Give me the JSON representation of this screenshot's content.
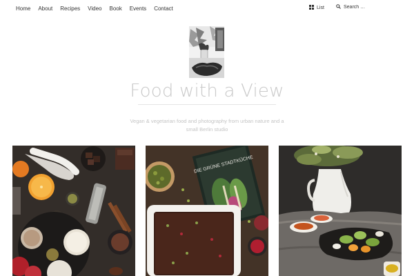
{
  "nav": {
    "items": [
      {
        "label": "Home"
      },
      {
        "label": "About"
      },
      {
        "label": "Recipes"
      },
      {
        "label": "Video"
      },
      {
        "label": "Book"
      },
      {
        "label": "Events"
      },
      {
        "label": "Contact"
      }
    ],
    "view_toggle": {
      "label": "List",
      "icon": "grid-icon"
    },
    "search": {
      "placeholder": "Search …",
      "icon": "search-icon"
    }
  },
  "header": {
    "title": "Food with a View",
    "tagline": "Vegan & vegetarian food and photography from urban nature and a small Berlin studio"
  },
  "posts": [
    {
      "image": "ingredients-flatlay-photo"
    },
    {
      "image": "cookbook-brownie-photo",
      "book_text": "DIE GRÜNE STADTKÜCHE"
    },
    {
      "image": "flowers-salad-photo"
    }
  ],
  "colors": {
    "title": "#c9c9c9",
    "tagline": "#c4c4c4",
    "nav_text": "#333333",
    "photo_dark": "#2b2623"
  }
}
